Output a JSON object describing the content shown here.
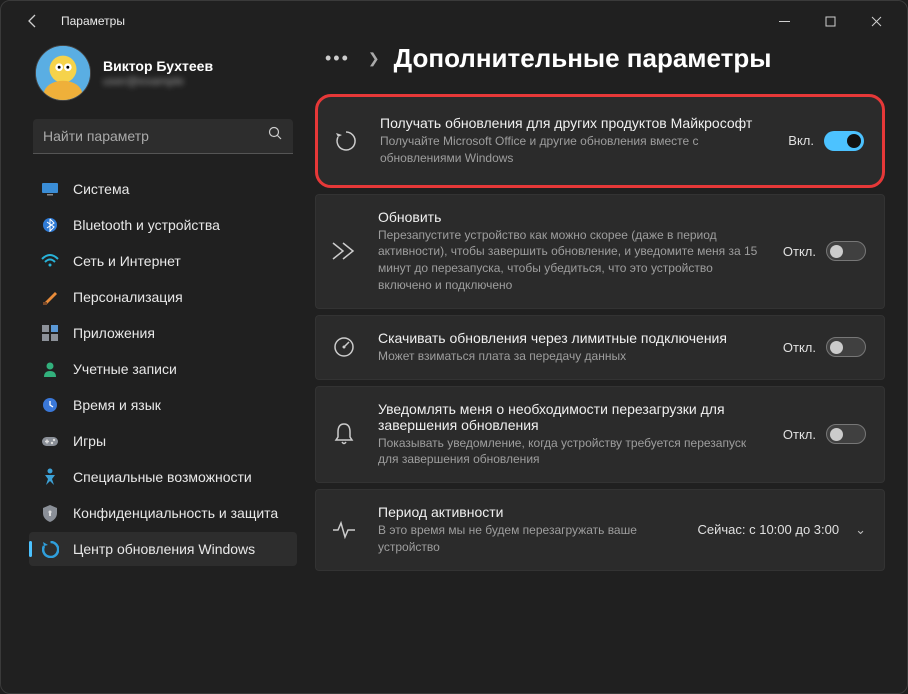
{
  "window": {
    "title": "Параметры"
  },
  "user": {
    "name": "Виктор Бухтеев",
    "email": "user@example"
  },
  "search": {
    "placeholder": "Найти параметр"
  },
  "nav": {
    "items": [
      {
        "label": "Система",
        "icon": "🖥️",
        "color": "#4cc2ff"
      },
      {
        "label": "Bluetooth и устройства",
        "icon": "bt",
        "color": "#2f7bd6"
      },
      {
        "label": "Сеть и Интернет",
        "icon": "wifi",
        "color": "#28b2d8"
      },
      {
        "label": "Персонализация",
        "icon": "brush",
        "color": "#e98c3a"
      },
      {
        "label": "Приложения",
        "icon": "apps",
        "color": "#8c9199"
      },
      {
        "label": "Учетные записи",
        "icon": "person",
        "color": "#32b07c"
      },
      {
        "label": "Время и язык",
        "icon": "clock",
        "color": "#3a78d9"
      },
      {
        "label": "Игры",
        "icon": "game",
        "color": "#8a8f97"
      },
      {
        "label": "Специальные возможности",
        "icon": "access",
        "color": "#3ca1d6"
      },
      {
        "label": "Конфиденциальность и защита",
        "icon": "shield",
        "color": "#8a8f97"
      },
      {
        "label": "Центр обновления Windows",
        "icon": "update",
        "color": "#2f9fdc"
      }
    ]
  },
  "header": {
    "page_title": "Дополнительные параметры"
  },
  "cards": [
    {
      "title": "Получать обновления для других продуктов Майкрософт",
      "desc": "Получайте Microsoft Office и другие обновления вместе с обновлениями Windows",
      "state_label": "Вкл.",
      "state": "on",
      "highlight": true,
      "icon": "refresh"
    },
    {
      "title": "Обновить",
      "desc": "Перезапустите устройство как можно скорее (даже в период активности), чтобы завершить обновление, и уведомите меня за 15 минут до перезапуска, чтобы убедиться, что это устройство включено и подключено",
      "state_label": "Откл.",
      "state": "off",
      "icon": "fast"
    },
    {
      "title": "Скачивать обновления через лимитные подключения",
      "desc": "Может взиматься плата за передачу данных",
      "state_label": "Откл.",
      "state": "off",
      "icon": "meter"
    },
    {
      "title": "Уведомлять меня о необходимости перезагрузки для завершения обновления",
      "desc": "Показывать уведомление, когда устройству требуется перезапуск для завершения обновления",
      "state_label": "Откл.",
      "state": "off",
      "icon": "bell"
    },
    {
      "title": "Период активности",
      "desc": "В это время мы не будем перезагружать ваше устройство",
      "state_label": "Сейчас: с 10:00 до 3:00",
      "state": "chevron",
      "icon": "activity"
    }
  ]
}
